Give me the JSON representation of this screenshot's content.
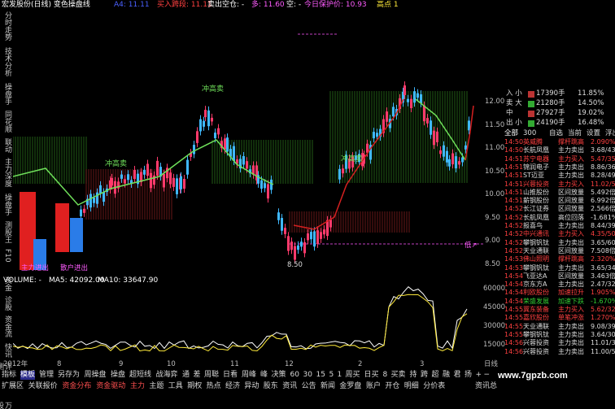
{
  "header": {
    "title": "宏发股份(日线) 变色操盘线",
    "indicator_prefix": "A4: 11.11",
    "buy_label": "买入跨段: 11.11",
    "sell_label": "卖出空仓: -",
    "multi_label": "多: 11.60",
    "empty_label": "空: -",
    "today_guard": "今日保护价: 10.93",
    "high_label": "高点 1"
  },
  "sidetabs": [
    "分时走势",
    "技术分析",
    "操盘手",
    "同花顺",
    "联动",
    "主力深度",
    "操盘手",
    "测股王",
    "F10",
    "资金",
    "诊股",
    "资金流",
    "快讯",
    "评测",
    "盘口",
    "万股"
  ],
  "chart_labels": {
    "chong_gao_mai_1": "冲高卖",
    "chong_gao_mai_2": "冲高卖",
    "chong_gao_mai_3": "冲高卖",
    "low_price": "8.50",
    "zhuli": "主力进出",
    "sanhu": "散户进出",
    "di_label": "低↗"
  },
  "price_axis": [
    "12.00",
    "11.50",
    "11.00",
    "10.50",
    "10.00",
    "9.50",
    "9.00",
    "8.50"
  ],
  "volume": {
    "label": "VOLUME: -",
    "ma5": "MA5: 42092.00",
    "ma10": "MA10: 33647.90",
    "axis": [
      "60000",
      "45000",
      "30000",
      "15000"
    ]
  },
  "order_book": {
    "rows": [
      {
        "label": "入 小",
        "value": "17390手",
        "pct": "11.85%",
        "color": "#b33"
      },
      {
        "label": "卖 大",
        "value": "21280手",
        "pct": "14.50%",
        "color": "#3a3"
      },
      {
        "label": "中",
        "value": "27927手",
        "pct": "19.02%",
        "color": "#b33"
      },
      {
        "label": "出 小",
        "value": "24190手",
        "pct": "16.48%",
        "color": "#3a3"
      }
    ]
  },
  "list_tabs": [
    "全部",
    "300",
    "自选",
    "当前",
    "设置",
    "浮出",
    "扩?"
  ],
  "list_rows": [
    {
      "time": "14:50",
      "name": "英威腾",
      "type": "撑杆跳高",
      "val": "2.090%",
      "tc": "#ff4040",
      "nc": "#ff4040",
      "vc": "#ff4040"
    },
    {
      "time": "14:50",
      "name": "长航凤凰",
      "type": "主力卖出",
      "val": "3.68/43",
      "tc": "#ff4040",
      "nc": "#ddd",
      "vc": "#ddd"
    },
    {
      "time": "14:51",
      "name": "苏宁电器",
      "type": "主力买入",
      "val": "5.47/35",
      "tc": "#ff4040",
      "nc": "#ff4040",
      "vc": "#ff4040"
    },
    {
      "time": "14:51",
      "name": "锦润电子",
      "type": "主力卖出",
      "val": "8.86/36",
      "tc": "#ff4040",
      "nc": "#ddd",
      "vc": "#ddd"
    },
    {
      "time": "14:51",
      "name": "ST迈亚",
      "type": "主力卖出",
      "val": "8.28/49",
      "tc": "#ff4040",
      "nc": "#ddd",
      "vc": "#ddd"
    },
    {
      "time": "14:51",
      "name": "兴蓉投资",
      "type": "主力买入",
      "val": "11.02/5",
      "tc": "#ff4040",
      "nc": "#ff4040",
      "vc": "#ff4040"
    },
    {
      "time": "14:51",
      "name": "山推股份",
      "type": "区间放量",
      "val": "5.492倍",
      "tc": "#ff4040",
      "nc": "#ddd",
      "vc": "#ddd"
    },
    {
      "time": "14:51",
      "name": "薪钢股份",
      "type": "区间放量",
      "val": "6.992倍",
      "tc": "#ff4040",
      "nc": "#ddd",
      "vc": "#ddd"
    },
    {
      "time": "14:52",
      "name": "长江证券",
      "type": "区间放量",
      "val": "2.566倍",
      "tc": "#ff4040",
      "nc": "#ddd",
      "vc": "#ddd"
    },
    {
      "time": "14:52",
      "name": "长航凤凰",
      "type": "高位回落",
      "val": "-1.681%",
      "tc": "#ff4040",
      "nc": "#ddd",
      "vc": "#ddd"
    },
    {
      "time": "14:52",
      "name": "报喜鸟",
      "type": "主力卖出",
      "val": "8.44/39",
      "tc": "#ff4040",
      "nc": "#ddd",
      "vc": "#ddd"
    },
    {
      "time": "14:52",
      "name": "中兴通讯",
      "type": "主力买入",
      "val": "4.35/50",
      "tc": "#ff4040",
      "nc": "#ff4040",
      "vc": "#ff4040"
    },
    {
      "time": "14:52",
      "name": "攀钢钒钛",
      "type": "主力卖出",
      "val": "3.65/60",
      "tc": "#ff4040",
      "nc": "#ddd",
      "vc": "#ddd"
    },
    {
      "time": "14:52",
      "name": "天业通联",
      "type": "区间放量",
      "val": "7.508倍",
      "tc": "#ff4040",
      "nc": "#ddd",
      "vc": "#ddd"
    },
    {
      "time": "14:53",
      "name": "佛山照明",
      "type": "撑杆跳高",
      "val": "2.320%",
      "tc": "#ff4040",
      "nc": "#ff4040",
      "vc": "#ff4040"
    },
    {
      "time": "14:53",
      "name": "攀钢钒钛",
      "type": "主力卖出",
      "val": "3.65/34",
      "tc": "#ff4040",
      "nc": "#ddd",
      "vc": "#ddd"
    },
    {
      "time": "14:54",
      "name": "飞亚达A",
      "type": "区间放量",
      "val": "3.463倍",
      "tc": "#ff4040",
      "nc": "#ddd",
      "vc": "#ddd"
    },
    {
      "time": "14:54",
      "name": "京东方A",
      "type": "主力卖出",
      "val": "2.47/32",
      "tc": "#ff4040",
      "nc": "#ddd",
      "vc": "#ddd"
    },
    {
      "time": "14:54",
      "name": "利欧股份",
      "type": "加速拉升",
      "val": "1.905%",
      "tc": "#ff4040",
      "nc": "#ff4040",
      "vc": "#ff4040"
    },
    {
      "time": "14:54",
      "name": "荣盛发展",
      "type": "加速下跌",
      "val": "-1.670%",
      "tc": "#ff4040",
      "nc": "#3c3",
      "vc": "#3c3"
    },
    {
      "time": "14:55",
      "name": "冀东装备",
      "type": "主力买入",
      "val": "5.62/32",
      "tc": "#ff4040",
      "nc": "#ff4040",
      "vc": "#ff4040"
    },
    {
      "time": "14:55",
      "name": "嘉欣股份",
      "type": "单笔冲涨",
      "val": "1.270%",
      "tc": "#ff4040",
      "nc": "#ff4040",
      "vc": "#ff4040"
    },
    {
      "time": "14:55",
      "name": "天业通联",
      "type": "主力卖出",
      "val": "9.08/39",
      "tc": "#ff4040",
      "nc": "#ddd",
      "vc": "#ddd"
    },
    {
      "time": "14:55",
      "name": "攀钢钒钛",
      "type": "主力卖出",
      "val": "3.64/30",
      "tc": "#ff4040",
      "nc": "#ddd",
      "vc": "#ddd"
    },
    {
      "time": "14:56",
      "name": "兴蓉投资",
      "type": "主力卖出",
      "val": "11.01/3",
      "tc": "#ff4040",
      "nc": "#ddd",
      "vc": "#ddd"
    },
    {
      "time": "14:56",
      "name": "兴蓉投资",
      "type": "主力卖出",
      "val": "11.00/5",
      "tc": "#ff4040",
      "nc": "#ddd",
      "vc": "#ddd"
    }
  ],
  "xaxis": [
    "2012年",
    "8",
    "9",
    "10",
    "11",
    "12",
    "2",
    "3",
    "日线"
  ],
  "toolbar": [
    "指标",
    "模板",
    "管理",
    "另存为",
    "周操盘",
    "操盘",
    "超短线",
    "战海弈",
    "通",
    "差",
    "周聪",
    "日看",
    "周峰",
    "峰",
    "决策",
    "60",
    "30",
    "15",
    "5",
    "1",
    "周买",
    "日买",
    "8",
    "买卖",
    "持",
    "跨",
    "超",
    "融",
    "君",
    "扬",
    "+",
    "−"
  ],
  "bottombar": [
    "扩展区",
    "关联报价",
    "资金分布",
    "资金驱动",
    "主力",
    "主题",
    "工具",
    "期权",
    "热点",
    "经济",
    "异动",
    "股东",
    "资讯",
    "公告",
    "新闻",
    "金罗盘",
    "账户",
    "开仓",
    "明细",
    "分价表",
    "资讯总"
  ],
  "watermark": "www.7gpzb.com"
}
